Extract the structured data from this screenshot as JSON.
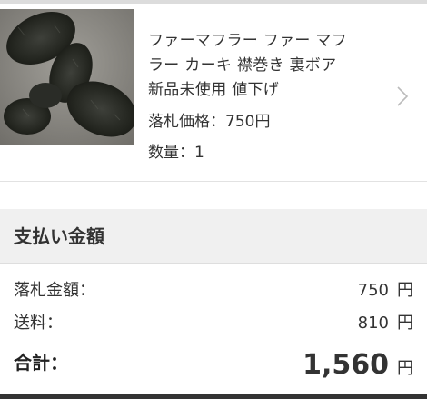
{
  "item": {
    "title_line1": "ファーマフラー ファー マフ",
    "title_line2": "ラー カーキ 襟巻き 裏ボア",
    "title_line3": "新品未使用 値下げ",
    "price_text": "落札価格：750円",
    "quantity_text": "数量：1",
    "thumbnail_icon": "fur-scarf-photo",
    "chevron_icon": "chevron-right-icon"
  },
  "payment": {
    "section_title": "支払い金額",
    "rows": [
      {
        "label": "落札金額：",
        "value": "750",
        "unit": "円"
      },
      {
        "label": "送料：",
        "value": "810",
        "unit": "円"
      }
    ],
    "total_label": "合計：",
    "total_value": "1,560",
    "total_unit": "円"
  },
  "colors": {
    "section_bg": "#f0f0f0",
    "text": "#333333",
    "divider": "#e2e2e2",
    "chevron": "#bbbbbb"
  }
}
